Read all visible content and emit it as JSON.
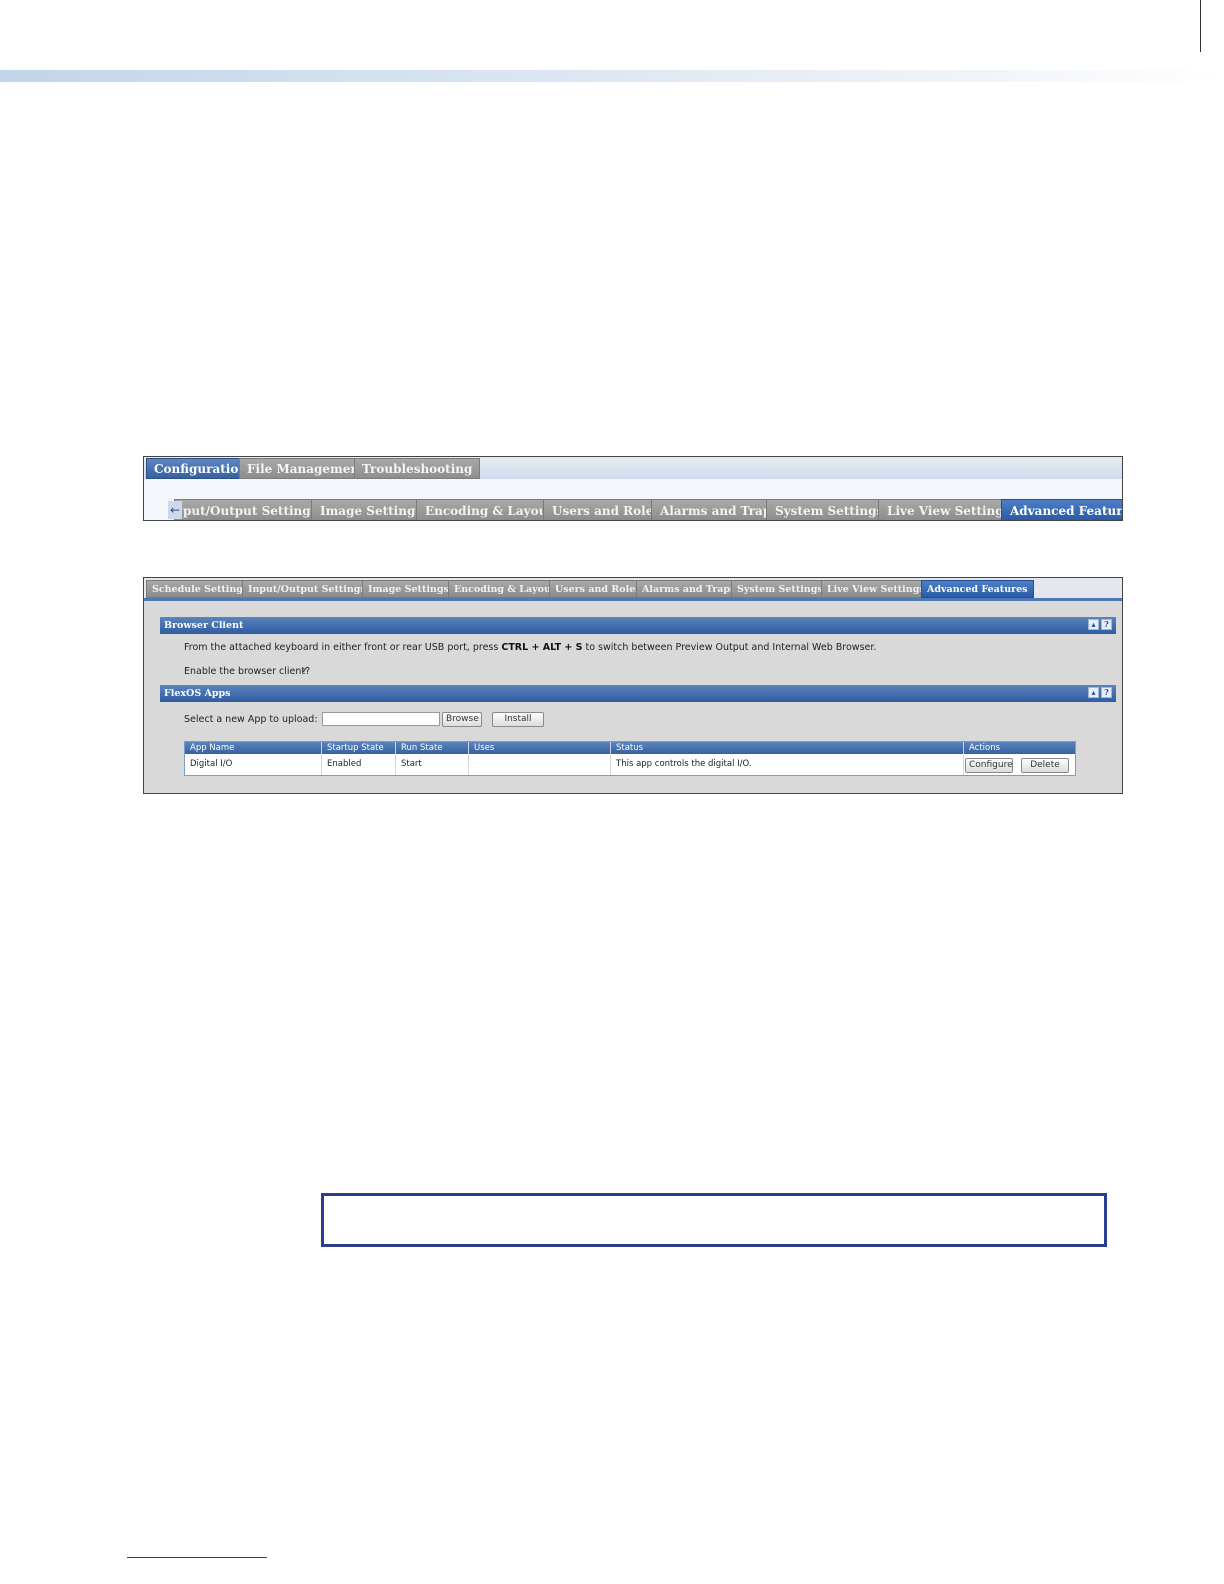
{
  "screenshot1": {
    "main_tabs": [
      {
        "label": "Configuration",
        "active": true
      },
      {
        "label": "File Management",
        "active": false
      },
      {
        "label": "Troubleshooting",
        "active": false
      }
    ],
    "sub_tabs": [
      {
        "label": "put/Output Settings",
        "active": false
      },
      {
        "label": "Image Settings",
        "active": false
      },
      {
        "label": "Encoding & Layout",
        "active": false
      },
      {
        "label": "Users and Roles",
        "active": false
      },
      {
        "label": "Alarms and Traps",
        "active": false
      },
      {
        "label": "System Settings",
        "active": false
      },
      {
        "label": "Live View Settings",
        "active": false
      },
      {
        "label": "Advanced Features",
        "active": true
      }
    ],
    "scroll_arrow": "←"
  },
  "screenshot2": {
    "tabs": [
      {
        "label": "Schedule Settings",
        "active": false
      },
      {
        "label": "Input/Output Settings",
        "active": false
      },
      {
        "label": "Image Settings",
        "active": false
      },
      {
        "label": "Encoding & Layout",
        "active": false
      },
      {
        "label": "Users and Roles",
        "active": false
      },
      {
        "label": "Alarms and Traps",
        "active": false
      },
      {
        "label": "System Settings",
        "active": false
      },
      {
        "label": "Live View Settings",
        "active": false
      },
      {
        "label": "Advanced Features",
        "active": true
      }
    ],
    "browser_client": {
      "title": "Browser Client",
      "desc_before": "From the attached keyboard in either front or rear USB port, press ",
      "desc_keys": "CTRL + ALT + S",
      "desc_after": " to switch between Preview Output and Internal Web Browser.",
      "enable_label": "Enable the browser client?",
      "enable_checked": "✓"
    },
    "flexos_apps": {
      "title": "FlexOS Apps",
      "upload_label": "Select a new App to upload:",
      "upload_value": "",
      "browse_label": "Browse",
      "install_label": "Install",
      "columns": [
        "App Name",
        "Startup State",
        "Run State",
        "Uses",
        "Status",
        "Actions"
      ],
      "rows": [
        {
          "app_name": "Digital I/O",
          "startup_state": "Enabled",
          "run_state": "Start",
          "uses": "",
          "status": "This app controls the digital I/O.",
          "configure_label": "Configure",
          "delete_label": "Delete"
        }
      ]
    },
    "panel_icons": [
      "▴",
      "?"
    ]
  },
  "colors": {
    "active_tab": "#36619f",
    "inactive_tab": "#8e8e8e",
    "note_border": "#2b3f8f"
  }
}
